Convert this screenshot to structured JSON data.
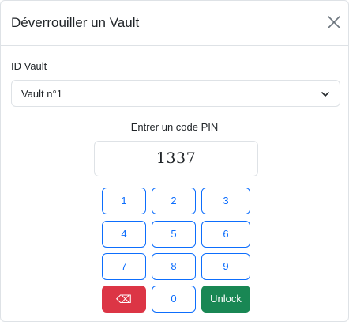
{
  "modal": {
    "title": "Déverrouiller un Vault",
    "close_icon": "close-icon"
  },
  "vault_field": {
    "label": "ID Vault",
    "selected": "Vault n°1",
    "icon": "chevron-down-icon"
  },
  "pin": {
    "label": "Entrer un code PIN",
    "value": "1337"
  },
  "keypad": {
    "keys": [
      "1",
      "2",
      "3",
      "4",
      "5",
      "6",
      "7",
      "8",
      "9"
    ],
    "backspace_label": "⌫",
    "zero_label": "0",
    "unlock_label": "Unlock"
  },
  "colors": {
    "primary": "#0d6efd",
    "danger": "#dc3545",
    "success": "#198754"
  }
}
